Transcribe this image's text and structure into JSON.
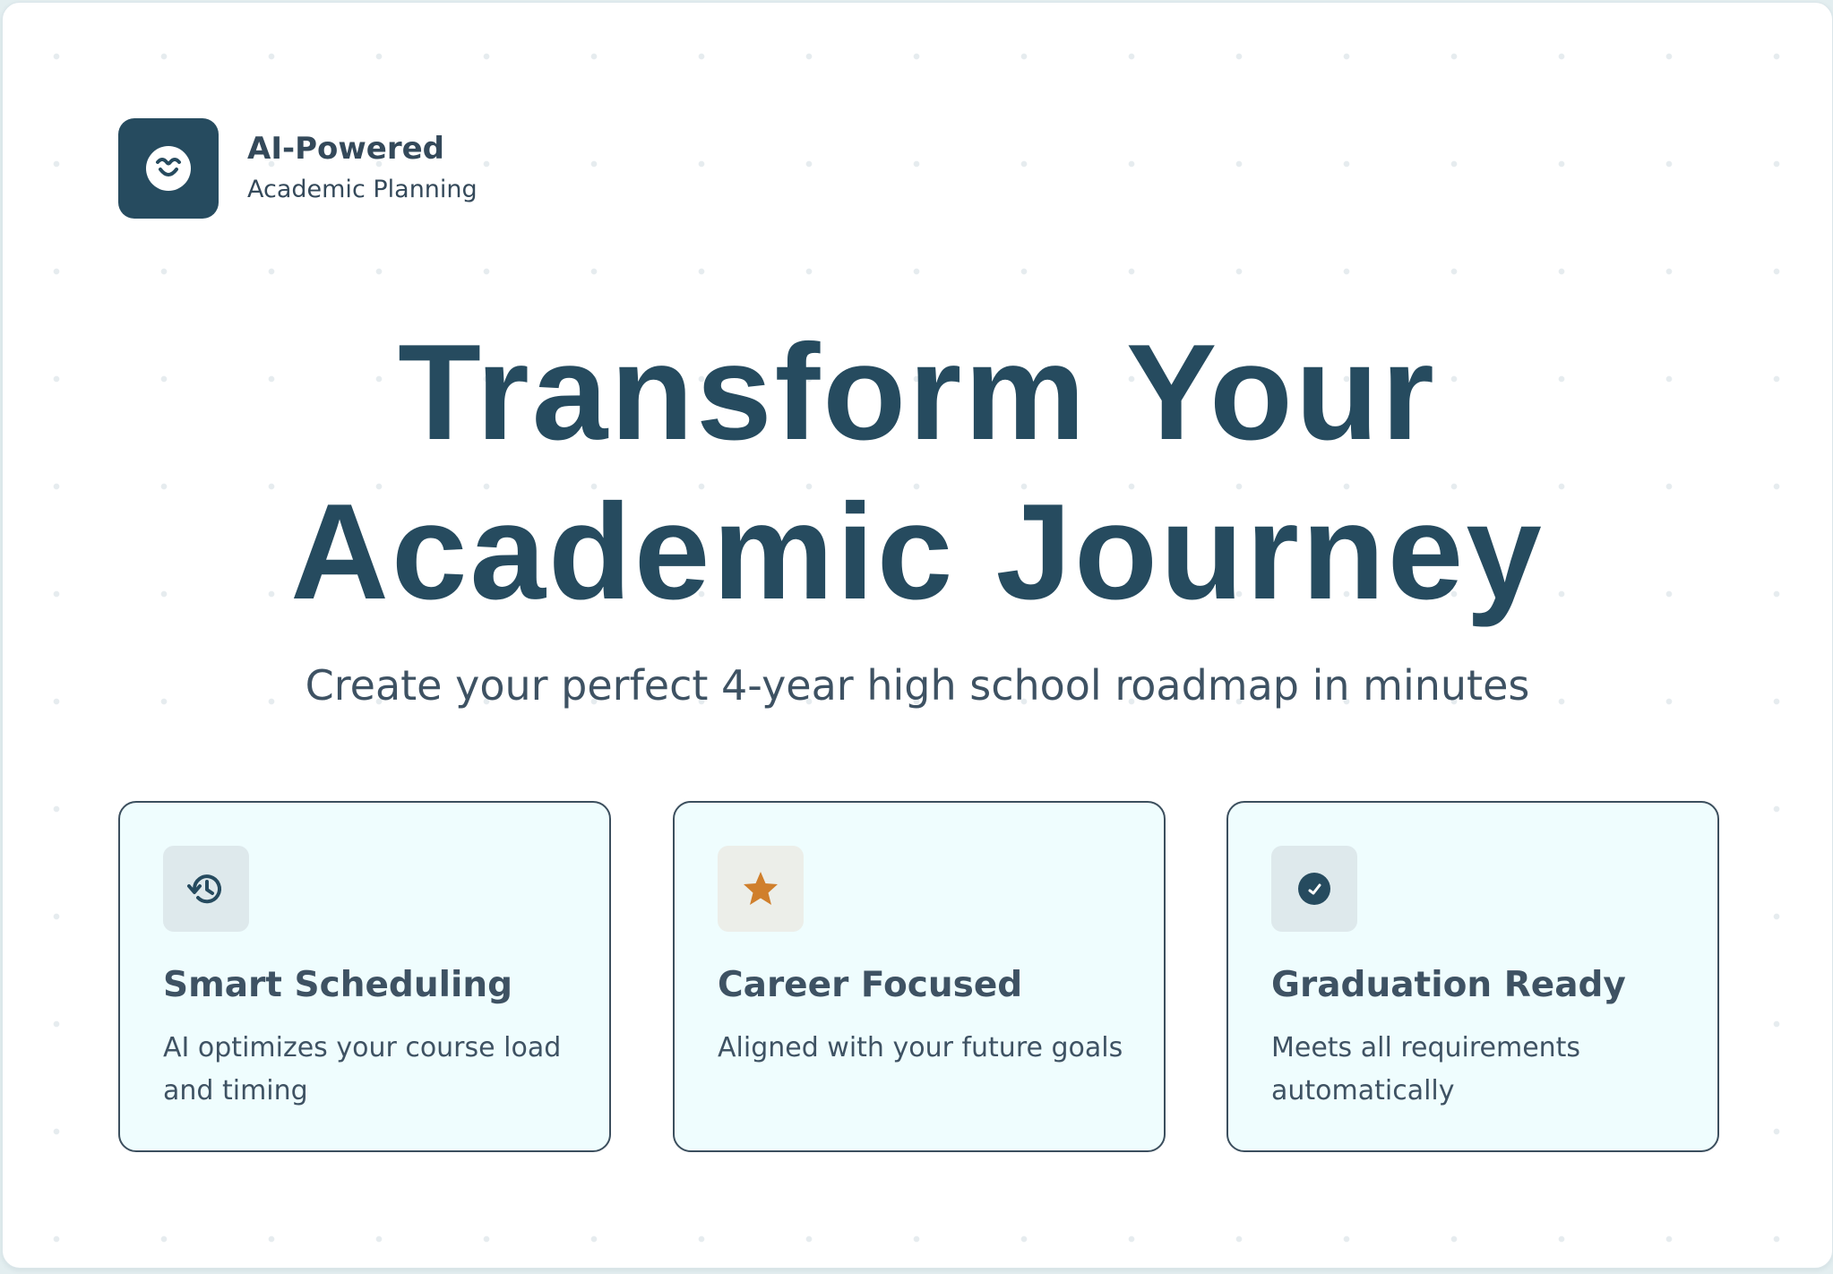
{
  "brand": {
    "title": "AI-Powered",
    "subtitle": "Academic Planning",
    "logo_icon": "heart-smile-icon"
  },
  "hero": {
    "line1": "Transform Your",
    "line2": "Academic Journey",
    "subtitle": "Create your perfect 4-year high school roadmap in minutes"
  },
  "features": [
    {
      "icon": "history-clock-icon",
      "title": "Smart Scheduling",
      "description": "AI optimizes your course load and timing"
    },
    {
      "icon": "star-icon",
      "title": "Career Focused",
      "description": "Aligned with your future goals"
    },
    {
      "icon": "check-circle-icon",
      "title": "Graduation Ready",
      "description": "Meets all requirements automatically"
    }
  ],
  "colors": {
    "primary": "#264b5f",
    "text": "#3e5263",
    "card_bg": "#effdfe",
    "accent_star": "#d07f2c"
  }
}
